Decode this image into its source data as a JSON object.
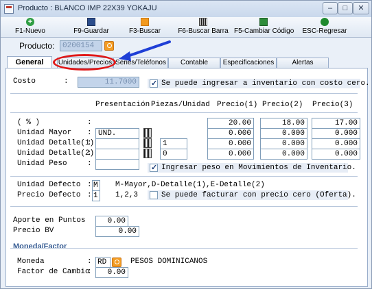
{
  "window": {
    "title": "Producto : BLANCO IMP 22X39 YOKAJU",
    "controls": {
      "minimize": "–",
      "maximize": "□",
      "close": "✕"
    }
  },
  "toolbar": {
    "buttons": [
      {
        "label": "F1-Nuevo",
        "icon": "plus-icon"
      },
      {
        "label": "F9-Guardar",
        "icon": "save-icon"
      },
      {
        "label": "F3-Buscar",
        "icon": "search-icon"
      },
      {
        "label": "F6-Buscar Barra",
        "icon": "barcode-icon"
      },
      {
        "label": "F5-Cambiar Código",
        "icon": "code-icon"
      },
      {
        "label": "ESC-Regresar",
        "icon": "back-icon"
      }
    ]
  },
  "product": {
    "label": "Producto:",
    "code": "0200154"
  },
  "tabs": [
    {
      "label": "General",
      "active": true
    },
    {
      "label": "Unidades/Precios",
      "active": false
    },
    {
      "label": "Series/Teléfonos",
      "active": false
    },
    {
      "label": "Contable",
      "active": false
    },
    {
      "label": "Especificaciones",
      "active": false
    },
    {
      "label": "Alertas",
      "active": false
    }
  ],
  "costo": {
    "label": "Costo",
    "colon": ":",
    "value": "11.7000",
    "zero_cost_checked": true,
    "zero_cost_label": "Se puede ingresar a inventario con costo cero."
  },
  "table": {
    "headers": {
      "presentacion": "Presentación",
      "piezas": "Piezas/Unidad",
      "p1": "Precio(1)",
      "p2": "Precio(2)",
      "p3": "Precio(3)"
    },
    "percent_label": "( % )",
    "percent_colon": ":",
    "percents": [
      "20.00",
      "18.00",
      "17.00"
    ],
    "rows": [
      {
        "label": "Unidad Mayor",
        "colon": ":",
        "presentacion": "UND.",
        "barcode": true,
        "piezas": null,
        "p1": "0.000",
        "p2": "0.000",
        "p3": "0.000"
      },
      {
        "label": "Unidad Detalle(1)",
        "colon": ":",
        "presentacion": "",
        "barcode": true,
        "piezas": "1",
        "p1": "0.000",
        "p2": "0.000",
        "p3": "0.000"
      },
      {
        "label": "Unidad Detalle(2)",
        "colon": ":",
        "presentacion": "",
        "barcode": true,
        "piezas": "0",
        "p1": "0.000",
        "p2": "0.000",
        "p3": "0.000"
      },
      {
        "label": "Unidad Peso",
        "colon": ":",
        "presentacion": "",
        "barcode": false,
        "piezas": null,
        "p1": null,
        "p2": null,
        "p3": null
      }
    ],
    "peso_checked": true,
    "peso_label": "Ingresar peso en Movimientos de Inventario."
  },
  "defaults": {
    "unidad_label": "Unidad Defecto",
    "colon": ":",
    "unidad_value": "M",
    "unidad_hint": "M-Mayor,D-Detalle(1),E-Detalle(2)",
    "precio_label": "Precio Defecto",
    "precio_value": "1",
    "precio_hint": "1,2,3",
    "zero_price_checked": false,
    "zero_price_label": "Se puede facturar con precio cero (Oferta)."
  },
  "points": {
    "aporte_label": "Aporte en Puntos",
    "aporte_value": "0.00",
    "bv_label": "Precio BV",
    "bv_value": "0.00"
  },
  "currency": {
    "section_title": "Moneda/Factor",
    "moneda_label": "Moneda",
    "colon": ":",
    "moneda_code": "RD",
    "moneda_name": "PESOS DOMINICANOS",
    "factor_label": "Factor de Cambio",
    "factor_value": "0.00"
  },
  "colors": {
    "annotation_red": "#e01818",
    "annotation_blue": "#1f3fd6"
  }
}
